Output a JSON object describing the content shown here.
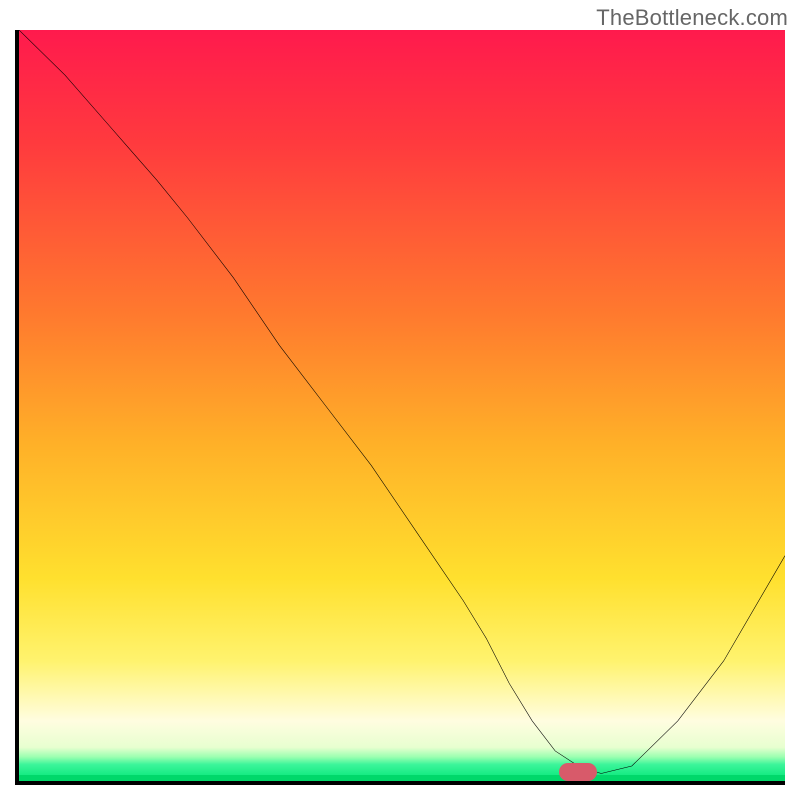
{
  "watermark": "TheBottleneck.com",
  "chart_data": {
    "type": "line",
    "title": "",
    "xlabel": "",
    "ylabel": "",
    "xlim": [
      0,
      100
    ],
    "ylim": [
      0,
      100
    ],
    "grid": false,
    "legend": false,
    "series": [
      {
        "name": "bottleneck-curve",
        "x": [
          0,
          6,
          12,
          18,
          22,
          28,
          34,
          40,
          46,
          52,
          58,
          61,
          64,
          67,
          70,
          73,
          76,
          80,
          86,
          92,
          100
        ],
        "y": [
          100,
          94,
          87,
          80,
          75,
          67,
          58,
          50,
          42,
          33,
          24,
          19,
          13,
          8,
          4,
          2,
          1,
          2,
          8,
          16,
          30
        ]
      }
    ],
    "marker": {
      "name": "optimal-point",
      "x": 73,
      "y": 1.2,
      "color": "#d85a6a"
    },
    "background_gradient": {
      "stops": [
        {
          "pos": 0,
          "color": "#ff1a4d"
        },
        {
          "pos": 38,
          "color": "#ff7a2e"
        },
        {
          "pos": 73,
          "color": "#ffe02e"
        },
        {
          "pos": 92,
          "color": "#fffde0"
        },
        {
          "pos": 100,
          "color": "#00e676"
        }
      ]
    }
  }
}
